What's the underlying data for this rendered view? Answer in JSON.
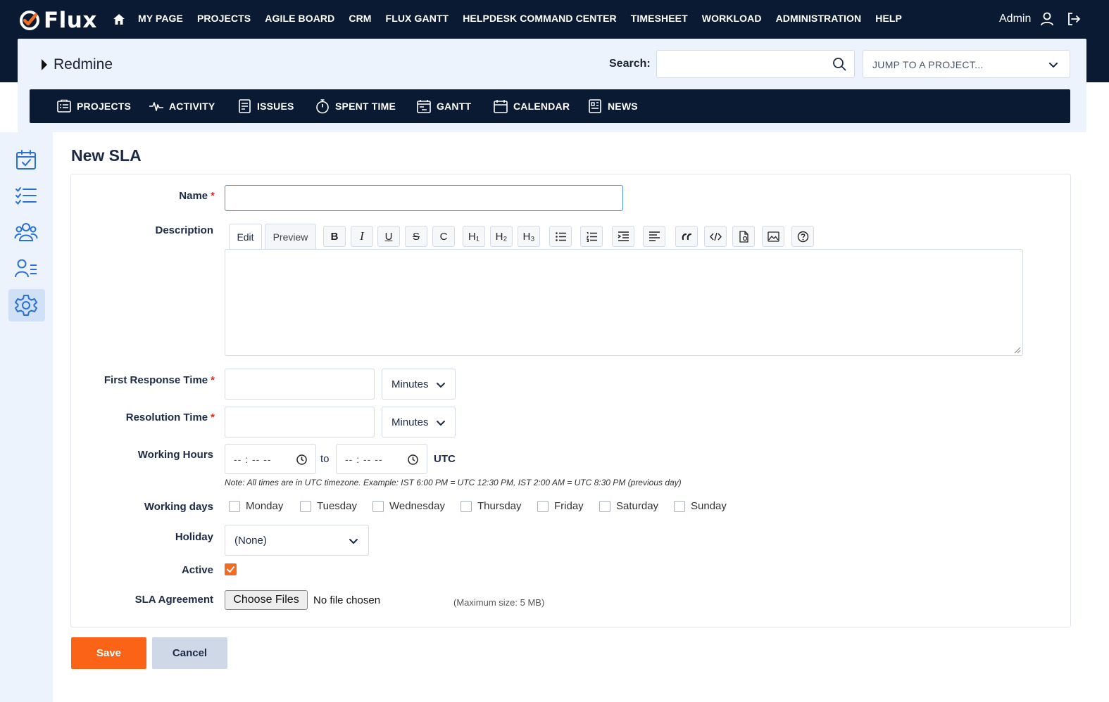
{
  "app": {
    "logo_text": "Flux"
  },
  "topnav": {
    "items": [
      "MY PAGE",
      "PROJECTS",
      "AGILE BOARD",
      "CRM",
      "FLUX GANTT",
      "HELPDESK COMMAND CENTER",
      "TIMESHEET",
      "WORKLOAD",
      "ADMINISTRATION",
      "HELP"
    ],
    "user": "Admin"
  },
  "header": {
    "breadcrumb": "Redmine",
    "search_label": "Search:",
    "search_value": "",
    "jump_label": "JUMP TO A PROJECT..."
  },
  "menu": {
    "items": [
      "PROJECTS",
      "ACTIVITY",
      "ISSUES",
      "SPENT TIME",
      "GANTT",
      "CALENDAR",
      "NEWS"
    ]
  },
  "sidebar": {
    "icons": [
      "calendar-check-icon",
      "task-list-icon",
      "users-icon",
      "user-list-icon",
      "gear-icon"
    ],
    "active": "gear-icon"
  },
  "page": {
    "title": "New SLA"
  },
  "form": {
    "name_label": "Name",
    "required_mark": "*",
    "name_value": "",
    "description_label": "Description",
    "tabs": {
      "edit": "Edit",
      "preview": "Preview"
    },
    "toolbar_text": {
      "bold": "B",
      "italic": "I",
      "underline": "U",
      "strike": "S",
      "code": "C",
      "h1": "H₁",
      "h2": "H₂",
      "h3": "H₃"
    },
    "first_response_label": "First Response Time",
    "first_response_value": "",
    "first_response_unit": "Minutes",
    "resolution_label": "Resolution Time",
    "resolution_value": "",
    "resolution_unit": "Minutes",
    "working_hours_label": "Working Hours",
    "time_placeholder": "-- : --   --",
    "to": "to",
    "timezone": "UTC",
    "note": "Note: All times are in UTC timezone. Example: IST 6:00 PM = UTC 12:30 PM, IST 2:00 AM = UTC 8:30 PM (previous day)",
    "working_days_label": "Working days",
    "days": [
      "Monday",
      "Tuesday",
      "Wednesday",
      "Thursday",
      "Friday",
      "Saturday",
      "Sunday"
    ],
    "holiday_label": "Holiday",
    "holiday_value": "(None)",
    "active_label": "Active",
    "active_checked": true,
    "agreement_label": "SLA Agreement",
    "choose_files": "Choose Files",
    "no_file": "No file chosen",
    "max_size": "(Maximum size: 5 MB)"
  },
  "actions": {
    "save": "Save",
    "cancel": "Cancel"
  },
  "colors": {
    "navy": "#0b1a33",
    "accent": "#fb6416",
    "link_blue": "#2a6fd6",
    "panel": "#edf3fc"
  }
}
